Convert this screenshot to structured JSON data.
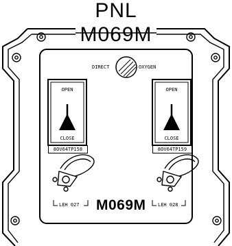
{
  "header": {
    "line1": "PNL",
    "line2": "M069M"
  },
  "panel": {
    "name": "M069M",
    "indicator_left": "DIRECT",
    "indicator_right": "OXYGEN",
    "footer_left": "LEH 027",
    "footer_right": "LEH 028"
  },
  "valves": [
    {
      "open_label": "OPEN",
      "close_label": "CLOSE",
      "tag": "8OV64TP158"
    },
    {
      "open_label": "OPEN",
      "close_label": "CLOSE",
      "tag": "8OV64TP159"
    }
  ]
}
